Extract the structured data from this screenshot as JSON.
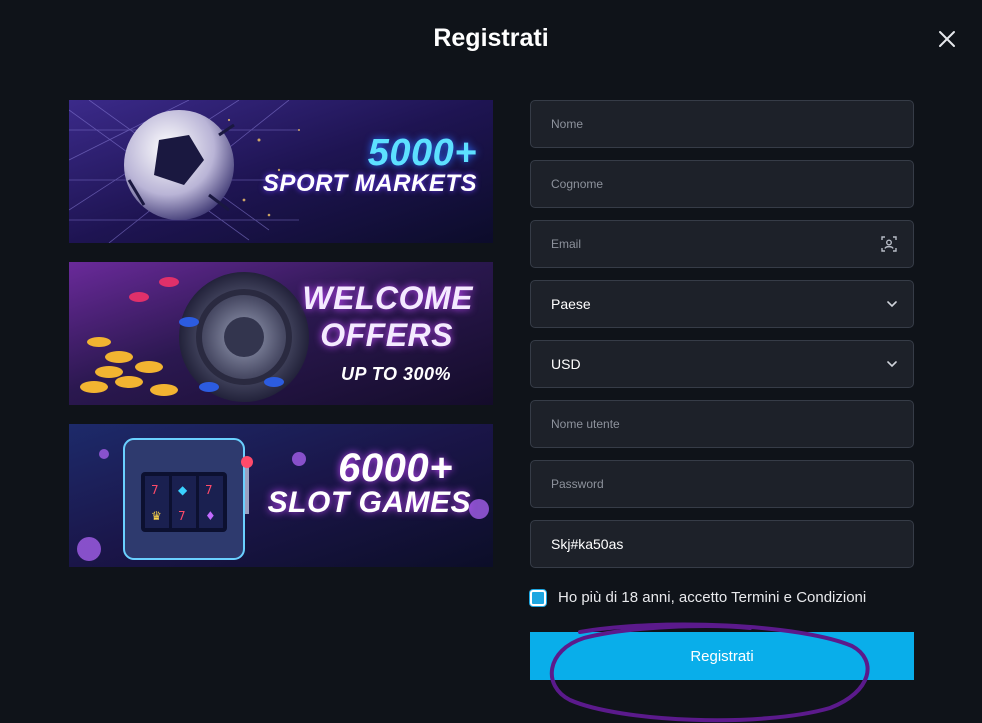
{
  "modal": {
    "title": "Registrati"
  },
  "banners": [
    {
      "line1": "5000+",
      "line2": "SPORT MARKETS"
    },
    {
      "line1": "WELCOME",
      "line2": "OFFERS",
      "line3": "UP TO 300%"
    },
    {
      "line1": "6000+",
      "line2": "SLOT GAMES"
    }
  ],
  "form": {
    "first_name_placeholder": "Nome",
    "last_name_placeholder": "Cognome",
    "email_placeholder": "Email",
    "country_value": "Paese",
    "currency_value": "USD",
    "username_placeholder": "Nome utente",
    "password_placeholder": "Password",
    "promo_value": "Skj#ka50as",
    "terms_label": "Ho più di 18 anni, accetto Termini e Condizioni",
    "terms_checked": true,
    "submit_label": "Registrati"
  },
  "icons": {
    "close": "close-icon",
    "contact": "contact-card-icon",
    "chevron": "chevron-down-icon"
  },
  "colors": {
    "background": "#0f1319",
    "field_bg": "#1d2129",
    "field_border": "#363c47",
    "accent": "#09aeea",
    "scribble": "#5b1a8c"
  }
}
